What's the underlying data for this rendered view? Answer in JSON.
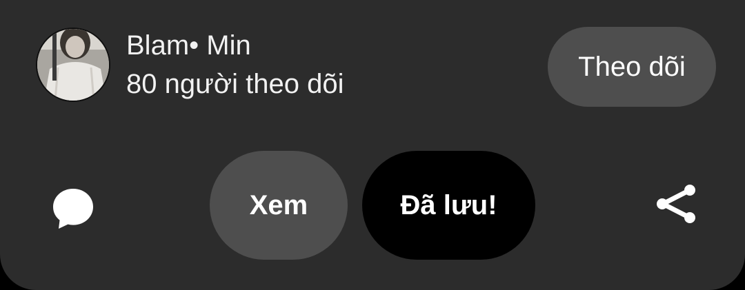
{
  "profile": {
    "name": "Blam• Min",
    "followers": "80 người theo dõi",
    "follow_label": "Theo dõi"
  },
  "actions": {
    "comment_icon": "speech-bubble",
    "view_label": "Xem",
    "saved_label": "Đã lưu!",
    "share_icon": "share-nodes"
  },
  "colors": {
    "sheet_background": "#2c2c2c",
    "secondary_button": "#4e4e4e",
    "saved_button": "#000000",
    "text": "#ffffff"
  }
}
